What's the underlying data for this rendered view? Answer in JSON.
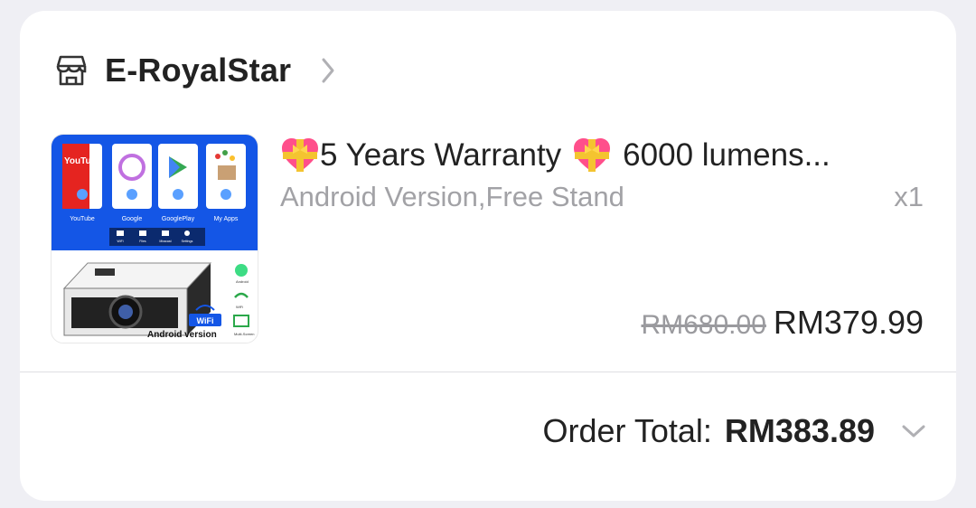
{
  "shop": {
    "name": "E-RoyalStar",
    "icon": "store-icon",
    "chevron_icon": "chevron-right-icon"
  },
  "product": {
    "title_part1": "5 Years Warranty",
    "title_part2": "6000 lumens...",
    "title_emoji": "heart-with-ribbon-icon",
    "variation": "Android Version,Free Stand",
    "quantity": "x1",
    "original_price": "RM680.00",
    "sale_price": "RM379.99",
    "image": {
      "apps": [
        "YouTube",
        "Google",
        "GooglePlay",
        "My Apps"
      ],
      "youtube_logo": "YouTube",
      "toolbar_items": [
        "WiFi",
        "Files",
        "Miracast",
        "Settings"
      ],
      "features": [
        "Android",
        "WiFi",
        "Multi-Screen"
      ],
      "wifi_badge": "WiFi",
      "caption": "Android version"
    }
  },
  "order": {
    "total_label": "Order Total:",
    "total_value": "RM383.89",
    "expand_icon": "chevron-down-icon"
  },
  "colors": {
    "background": "#efeff4",
    "card": "#ffffff",
    "text": "#222222",
    "muted": "#a2a2a6",
    "image_blue": "#1456e6"
  }
}
